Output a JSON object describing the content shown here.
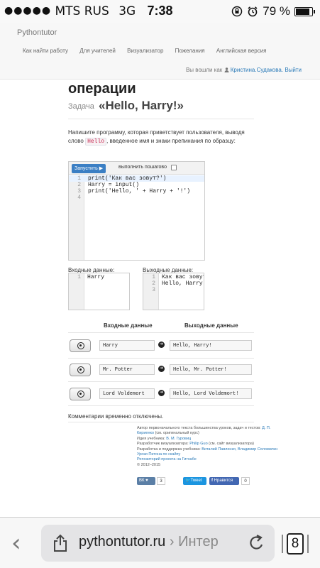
{
  "status_bar": {
    "signal_dots": "●●●●●",
    "carrier": "MTS RUS",
    "network": "3G",
    "time": "7:38",
    "battery": "79 %",
    "battery_level": 0.79
  },
  "site": {
    "brand": "Pythontutor",
    "nav": [
      "Как найти работу",
      "Для учителей",
      "Визуализатор",
      "Пожелания",
      "Английская версия"
    ],
    "user_prefix": "Вы вошли как",
    "user_name": "Кристина.Судакова.",
    "logout": "Выйти"
  },
  "page": {
    "heading": "операции",
    "task_prefix": "Задача",
    "task_title": "«Hello, Harry!»",
    "description_before": "Напишите программу, которая приветствует пользователя, выводя слово",
    "description_code": "Hello",
    "description_after": ", введенное имя и знаки препинания по образцу:"
  },
  "editor": {
    "run_label": "Запустить ▶",
    "step_label": "выполнить пошагово",
    "lines": [
      {
        "num": "1",
        "text": "print('Как вас зовут?')"
      },
      {
        "num": "2",
        "text": "Harry = input()"
      },
      {
        "num": "3",
        "text": "print('Hello, ' + Harry + '!')"
      },
      {
        "num": "4",
        "text": ""
      }
    ]
  },
  "io": {
    "input_label": "Входные данные:",
    "output_label": "Выходные данные:",
    "input_lines": [
      {
        "num": "1",
        "text": "Harry"
      }
    ],
    "output_lines": [
      {
        "num": "1",
        "text": "Как вас зовут"
      },
      {
        "num": "2",
        "text": "Hello, Harry!"
      },
      {
        "num": "3",
        "text": ""
      }
    ]
  },
  "tests": {
    "col_input": "Входные данные",
    "col_output": "Выходные данные",
    "rows": [
      {
        "input": "Harry",
        "output": "Hello, Harry!"
      },
      {
        "input": "Mr. Potter",
        "output": "Hello, Mr. Potter!"
      },
      {
        "input": "Lord Voldemort",
        "output": "Hello, Lord Voldemort!"
      }
    ]
  },
  "comments": "Комментарии временно отключены.",
  "footer": {
    "line1": "Автор первоначального текста большинства уроков, задач и тестов:",
    "line1_link": "Д. П.",
    "line2_link": "Кириенко",
    "line2": "(см. оригинальный курс)",
    "line3_label": "Идея учебника:",
    "line3_link": "В. М. Гуровиц",
    "line4_label": "Разработчик визуализатора:",
    "line4_link": "Philip Guo",
    "line4_after": "(см. сайт визуализатора)",
    "line5_label": "Разработка и поддержка учебника:",
    "line5_link": "Виталий Павленко, Владимир Соломатин",
    "line6_link": "Уроки Питона по скайпу",
    "line7_link": "Репозиторий проекта на Гитхабе",
    "copyright": "© 2012–2015"
  },
  "social": {
    "vk": "ВК",
    "vk_count": "3",
    "tweet": "Tweet",
    "fb": "Нравится",
    "fb_count": "0"
  },
  "browser": {
    "domain": "pythontutor.ru",
    "separator": "›",
    "path": "Интер",
    "tabs_count": "8"
  }
}
